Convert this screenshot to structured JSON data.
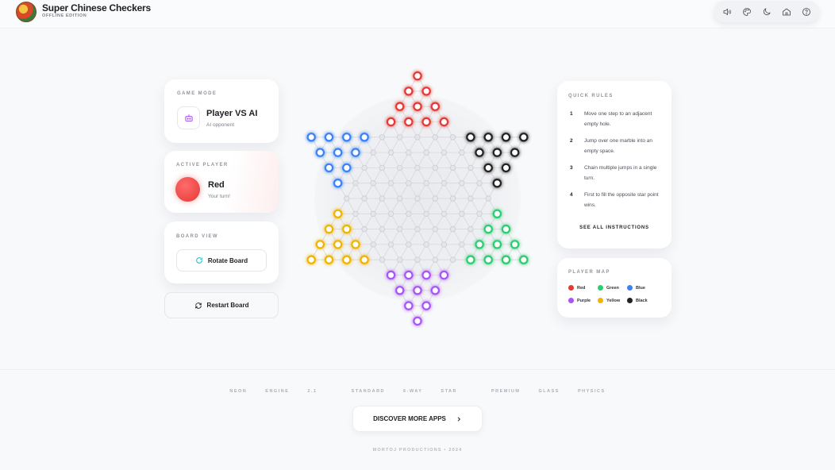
{
  "header": {
    "title": "Super Chinese Checkers",
    "subtitle": "OFFLINE EDITION",
    "toolbar": [
      {
        "name": "sound-button",
        "icon": "speaker-icon"
      },
      {
        "name": "theme-button",
        "icon": "palette-icon"
      },
      {
        "name": "dark-mode-button",
        "icon": "moon-icon"
      },
      {
        "name": "home-button",
        "icon": "home-icon"
      },
      {
        "name": "help-button",
        "icon": "question-icon"
      }
    ]
  },
  "game_mode": {
    "label": "GAME MODE",
    "title": "Player VS AI",
    "subtitle": "AI opponent",
    "icon": "robot-icon"
  },
  "active_player": {
    "label": "ACTIVE PLAYER",
    "name": "Red",
    "subtitle": "Your turn!",
    "color": "#e53935"
  },
  "board_view": {
    "label": "BOARD VIEW",
    "rotate_label": "Rotate Board"
  },
  "restart_label": "Restart Board",
  "quick_rules": {
    "label": "QUICK RULES",
    "rules": [
      {
        "num": "1",
        "text": "Move one step to an adjacent empty hole."
      },
      {
        "num": "2",
        "text": "Jump over one marble into an empty space."
      },
      {
        "num": "3",
        "text": "Chain multiple jumps in a single turn."
      },
      {
        "num": "4",
        "text": "First to fill the opposite star point wins."
      }
    ],
    "see_all": "SEE ALL INSTRUCTIONS"
  },
  "player_map": {
    "label": "PLAYER MAP",
    "players": [
      {
        "name": "Red",
        "color": "#e53935"
      },
      {
        "name": "Green",
        "color": "#2ecc71"
      },
      {
        "name": "Blue",
        "color": "#3b82f6"
      },
      {
        "name": "Purple",
        "color": "#a855f7"
      },
      {
        "name": "Yellow",
        "color": "#f0b400"
      },
      {
        "name": "Black",
        "color": "#222222"
      }
    ]
  },
  "board": {
    "pieces": {
      "top": "#e53935",
      "upper_right": "#222222",
      "lower_right": "#2ecc71",
      "bottom": "#a855f7",
      "lower_left": "#f0b400",
      "upper_left": "#3b82f6"
    },
    "empty_color": "#c9ccd2"
  },
  "footer": {
    "tags": [
      "NEON ENGINE 2.1",
      "STANDARD 6-WAY STAR",
      "PREMIUM GLASS PHYSICS"
    ],
    "discover_label": "DISCOVER MORE APPS",
    "copyright": "MORTOJ PRODUCTIONS • 2024"
  }
}
